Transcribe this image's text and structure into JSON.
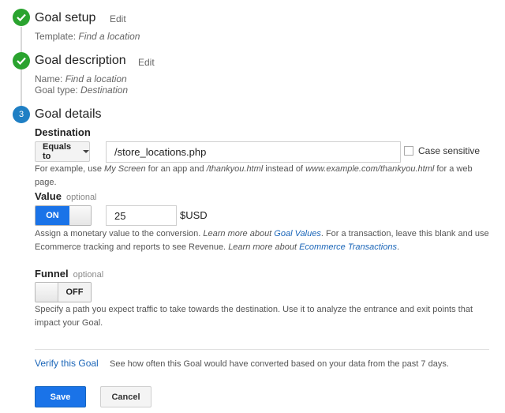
{
  "steps": {
    "setup": {
      "number": "",
      "title": "Goal setup",
      "edit": "Edit",
      "template_label": "Template:",
      "template_value": "Find a location"
    },
    "description": {
      "title": "Goal description",
      "edit": "Edit",
      "name_label": "Name:",
      "name_value": "Find a location",
      "type_label": "Goal type:",
      "type_value": "Destination"
    },
    "details": {
      "number": "3",
      "title": "Goal details"
    }
  },
  "destination": {
    "label": "Destination",
    "match_type": "Equals to",
    "value": "/store_locations.php",
    "case_sensitive_label": "Case sensitive",
    "case_sensitive_checked": false,
    "help": {
      "t1": "For example, use ",
      "i1": "My Screen",
      "t2": " for an app and ",
      "i2": "/thankyou.html",
      "t3": " instead of ",
      "i3": "www.example.com/thankyou.html",
      "t4": " for a web page."
    }
  },
  "value": {
    "label": "Value",
    "optional": "optional",
    "toggle": "ON",
    "amount": "25",
    "currency": "$USD",
    "help": {
      "t1": "Assign a monetary value to the conversion. ",
      "i1": "Learn more about ",
      "l1": "Goal Values",
      "t2": ". For a transaction, leave this blank and use Ecommerce tracking and reports to see Revenue. ",
      "i2": "Learn more about ",
      "l2": "Ecommerce Transactions",
      "t3": "."
    }
  },
  "funnel": {
    "label": "Funnel",
    "optional": "optional",
    "toggle": "OFF",
    "help": "Specify a path you expect traffic to take towards the destination. Use it to analyze the entrance and exit points that impact your Goal."
  },
  "verify": {
    "link": "Verify this Goal",
    "text": "See how often this Goal would have converted based on your data from the past 7 days."
  },
  "actions": {
    "save": "Save",
    "cancel": "Cancel"
  },
  "colors": {
    "done": "#2aa32f",
    "active": "#1f7fc4",
    "primary": "#1a73e8",
    "link": "#1a65b8"
  }
}
